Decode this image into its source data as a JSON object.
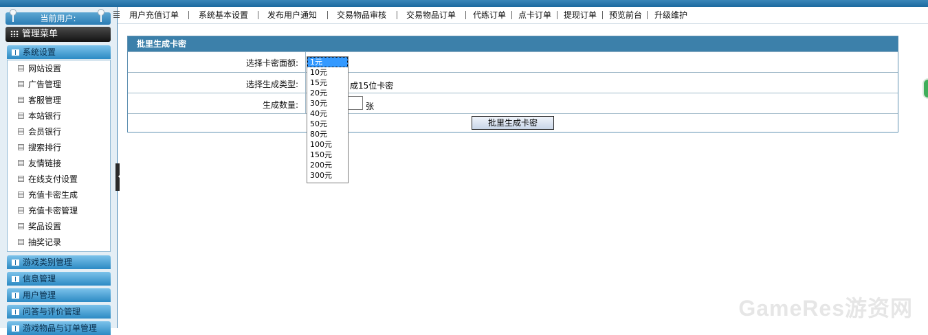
{
  "sidebar": {
    "current_user_label": "当前用户:",
    "menu_title": "管理菜单",
    "categories": [
      {
        "label": "系统设置"
      },
      {
        "label": "游戏类别管理"
      },
      {
        "label": "信息管理"
      },
      {
        "label": "用户管理"
      },
      {
        "label": "问答与评价管理"
      },
      {
        "label": "游戏物品与订单管理"
      }
    ],
    "items": [
      {
        "label": "网站设置"
      },
      {
        "label": "广告管理"
      },
      {
        "label": "客服管理"
      },
      {
        "label": "本站银行"
      },
      {
        "label": "会员银行"
      },
      {
        "label": "搜索排行"
      },
      {
        "label": "友情链接"
      },
      {
        "label": "在线支付设置"
      },
      {
        "label": "充值卡密生成"
      },
      {
        "label": "充值卡密管理"
      },
      {
        "label": "奖品设置"
      },
      {
        "label": "抽奖记录"
      }
    ],
    "highlighted_item": "充值卡密生成"
  },
  "nav": {
    "items": [
      {
        "label": "用户充值订单"
      },
      {
        "label": "系统基本设置"
      },
      {
        "label": "发布用户通知"
      },
      {
        "label": "交易物品审核"
      },
      {
        "label": "交易物品订单"
      },
      {
        "label": "代练订单"
      },
      {
        "label": "点卡订单"
      },
      {
        "label": "提现订单"
      },
      {
        "label": "预览前台"
      },
      {
        "label": "升级维护"
      }
    ]
  },
  "form": {
    "title": "批里生成卡密",
    "denomination_label": "选择卡密面额:",
    "type_label": "选择生成类型:",
    "type_value_text": "成15位卡密",
    "quantity_label": "生成数量:",
    "quantity_value": "",
    "quantity_unit": "张",
    "submit_label": "批里生成卡密",
    "denomination_options": [
      "1元",
      "10元",
      "15元",
      "20元",
      "30元",
      "40元",
      "50元",
      "80元",
      "100元",
      "150元",
      "200元",
      "300元"
    ],
    "denomination_selected": "1元"
  },
  "watermark": "GameRes游资网",
  "colors": {
    "header_blue": "#3c80aa",
    "selected_option": "#3399ff",
    "highlight_box": "#e02020"
  }
}
